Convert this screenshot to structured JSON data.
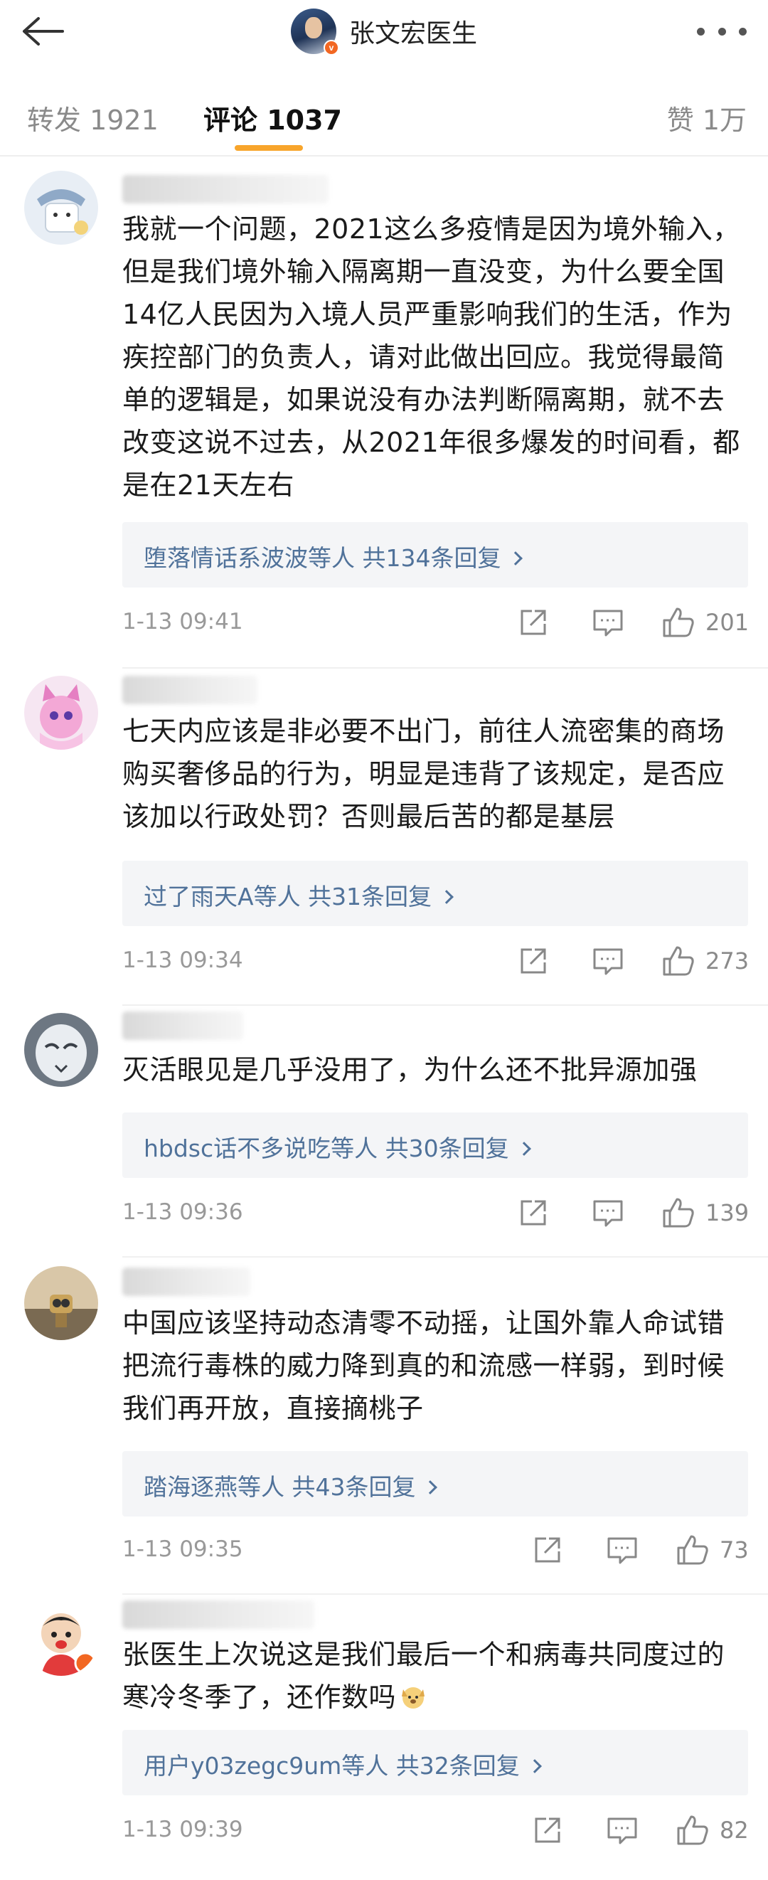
{
  "header": {
    "title": "张文宏医生",
    "back_icon": "back-arrow-icon",
    "more_icon": "more-dots-icon",
    "verified_badge": "v"
  },
  "tabs": [
    {
      "label": "转发 1921",
      "active": false
    },
    {
      "label": "评论 1037",
      "active": true
    },
    {
      "label": "赞 1万",
      "active": false
    }
  ],
  "accent_color": "#f8a52b",
  "link_color": "#50729a",
  "comments": [
    {
      "text": "我就一个问题，2021这么多疫情是因为境外输入，但是我们境外输入隔离期一直没变，为什么要全国14亿人民因为入境人员严重影响我们的生活，作为疾控部门的负责人，请对此做出回应。我觉得最简单的逻辑是，如果说没有办法判断隔离期，就不去改变这说不过去，从2021年很多爆发的时间看，都是在21天左右",
      "reply": "堕落情话系波波等人  共134条回复",
      "time": "1-13 09:41",
      "likes": "201"
    },
    {
      "text": "七天内应该是非必要不出门，前往人流密集的商场购买奢侈品的行为，明显是违背了该规定，是否应该加以行政处罚？否则最后苦的都是基层",
      "reply": "过了雨天A等人  共31条回复",
      "time": "1-13 09:34",
      "likes": "273"
    },
    {
      "text": "灭活眼见是几乎没用了，为什么还不批异源加强",
      "reply": "hbdsc话不多说吃等人  共30条回复",
      "time": "1-13 09:36",
      "likes": "139"
    },
    {
      "text": "中国应该坚持动态清零不动摇，让国外靠人命试错把流行毒株的威力降到真的和流感一样弱，到时候我们再开放，直接摘桃子",
      "reply": "踏海逐燕等人  共43条回复",
      "time": "1-13 09:35",
      "likes": "73"
    },
    {
      "text": "张医生上次说这是我们最后一个和病毒共同度过的寒冷冬季了，还作数吗",
      "reply": "用户y03zegc9um等人  共32条回复",
      "time": "1-13 09:39",
      "likes": "82"
    }
  ]
}
